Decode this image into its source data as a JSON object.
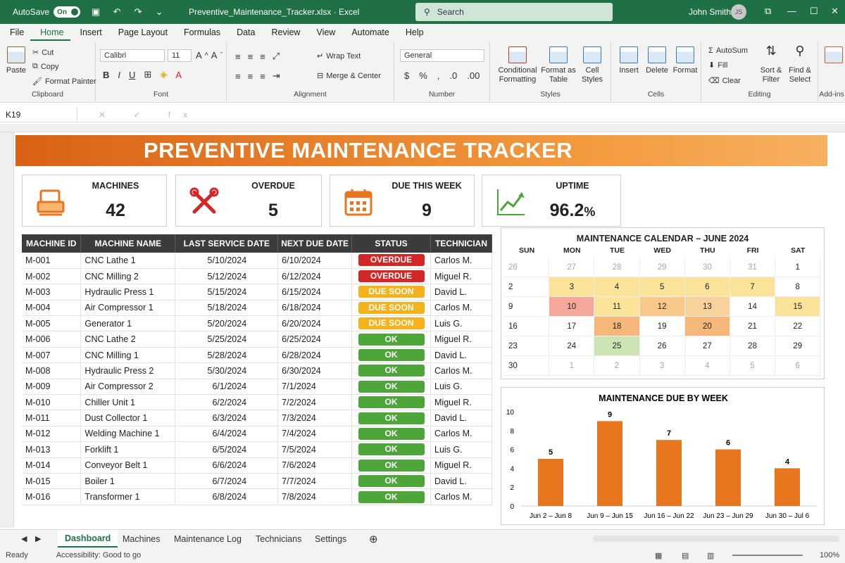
{
  "titlebar": {
    "autosave_label": "AutoSave",
    "toggle": "On",
    "filename": "Preventive_Maintenance_Tracker.xlsx · Excel",
    "search_placeholder": "Search",
    "user_name": "John Smith",
    "user_initials": "JS"
  },
  "menu": [
    "File",
    "Home",
    "Insert",
    "Page Layout",
    "Formulas",
    "Data",
    "Review",
    "View",
    "Automate",
    "Help"
  ],
  "ribbon": {
    "clipboard": {
      "paste": "Paste",
      "cut": "Cut",
      "copy": "Copy",
      "format_painter": "Format Painter",
      "label": "Clipboard"
    },
    "font": {
      "name": "Calibri",
      "size": "11",
      "label": "Font"
    },
    "alignment": {
      "wrap": "Wrap Text",
      "merge": "Merge & Center",
      "label": "Alignment"
    },
    "number": {
      "format": "General",
      "label": "Number"
    },
    "styles": {
      "conditional": "Conditional Formatting",
      "table": "Format as Table",
      "cell": "Cell Styles",
      "label": "Styles"
    },
    "cells": {
      "insert": "Insert",
      "delete": "Delete",
      "format": "Format",
      "label": "Cells"
    },
    "editing": {
      "autosum": "AutoSum",
      "fill": "Fill",
      "clear": "Clear",
      "sort": "Sort & Filter",
      "find": "Find & Select",
      "label": "Editing"
    },
    "addins": {
      "label": "Add-ins"
    }
  },
  "formula_bar": {
    "name_box": "K19",
    "fx": "✕ ✓ fx"
  },
  "banner": "PREVENTIVE MAINTENANCE TRACKER",
  "kpis": [
    {
      "label": "MACHINES",
      "value": "42",
      "icon": "machine-icon"
    },
    {
      "label": "OVERDUE",
      "value": "5",
      "icon": "tools-icon"
    },
    {
      "label": "DUE THIS WEEK",
      "value": "9",
      "icon": "calendar-icon"
    },
    {
      "label": "UPTIME",
      "value": "96.2",
      "unit": "%",
      "icon": "trend-up-icon"
    }
  ],
  "table": {
    "headers": [
      "MACHINE ID",
      "MACHINE NAME",
      "LAST SERVICE DATE",
      "NEXT DUE DATE",
      "STATUS",
      "TECHNICIAN"
    ],
    "rows": [
      [
        "M-001",
        "CNC Lathe 1",
        "5/10/2024",
        "6/10/2024",
        "OVERDUE",
        "Carlos M."
      ],
      [
        "M-002",
        "CNC Milling 2",
        "5/12/2024",
        "6/12/2024",
        "OVERDUE",
        "Miguel R."
      ],
      [
        "M-003",
        "Hydraulic Press 1",
        "5/15/2024",
        "6/15/2024",
        "DUE SOON",
        "David L."
      ],
      [
        "M-004",
        "Air Compressor 1",
        "5/18/2024",
        "6/18/2024",
        "DUE SOON",
        "Carlos M."
      ],
      [
        "M-005",
        "Generator 1",
        "5/20/2024",
        "6/20/2024",
        "DUE SOON",
        "Luis G."
      ],
      [
        "M-006",
        "CNC Lathe 2",
        "5/25/2024",
        "6/25/2024",
        "OK",
        "Miguel R."
      ],
      [
        "M-007",
        "CNC Milling 1",
        "5/28/2024",
        "6/28/2024",
        "OK",
        "David L."
      ],
      [
        "M-008",
        "Hydraulic Press 2",
        "5/30/2024",
        "6/30/2024",
        "OK",
        "Carlos M."
      ],
      [
        "M-009",
        "Air Compressor 2",
        "6/1/2024",
        "7/1/2024",
        "OK",
        "Luis G."
      ],
      [
        "M-010",
        "Chiller Unit 1",
        "6/2/2024",
        "7/2/2024",
        "OK",
        "Miguel R."
      ],
      [
        "M-011",
        "Dust Collector 1",
        "6/3/2024",
        "7/3/2024",
        "OK",
        "David L."
      ],
      [
        "M-012",
        "Welding Machine 1",
        "6/4/2024",
        "7/4/2024",
        "OK",
        "Carlos M."
      ],
      [
        "M-013",
        "Forklift 1",
        "6/5/2024",
        "7/5/2024",
        "OK",
        "Luis G."
      ],
      [
        "M-014",
        "Conveyor Belt 1",
        "6/6/2024",
        "7/6/2024",
        "OK",
        "Miguel R."
      ],
      [
        "M-015",
        "Boiler 1",
        "6/7/2024",
        "7/7/2024",
        "OK",
        "David L."
      ],
      [
        "M-016",
        "Transformer 1",
        "6/8/2024",
        "7/8/2024",
        "OK",
        "Carlos M."
      ]
    ],
    "status_colors": {
      "OVERDUE": "#d32626",
      "DUE SOON": "#f5b21b",
      "OK": "#4ea53a"
    }
  },
  "calendar": {
    "title": "MAINTENANCE CALENDAR – JUNE 2024",
    "dow": [
      "SUN",
      "MON",
      "TUE",
      "WED",
      "THU",
      "FRI",
      "SAT"
    ],
    "weeks": [
      [
        {
          "d": "26",
          "m": true
        },
        {
          "d": "27",
          "m": true
        },
        {
          "d": "28",
          "m": true
        },
        {
          "d": "29",
          "m": true
        },
        {
          "d": "30",
          "m": true
        },
        {
          "d": "31",
          "m": true
        },
        {
          "d": "1"
        }
      ],
      [
        {
          "d": "2"
        },
        {
          "d": "3",
          "c": "#fbe39a"
        },
        {
          "d": "4",
          "c": "#fbe39a"
        },
        {
          "d": "5",
          "c": "#fbe39a"
        },
        {
          "d": "6",
          "c": "#fbe39a"
        },
        {
          "d": "7",
          "c": "#fbe39a"
        },
        {
          "d": "8"
        }
      ],
      [
        {
          "d": "9"
        },
        {
          "d": "10",
          "c": "#f4a79a"
        },
        {
          "d": "11",
          "c": "#fbe39a"
        },
        {
          "d": "12",
          "c": "#f8c88b"
        },
        {
          "d": "13",
          "c": "#f8d29a"
        },
        {
          "d": "14"
        },
        {
          "d": "15",
          "c": "#fbe39a"
        }
      ],
      [
        {
          "d": "16"
        },
        {
          "d": "17"
        },
        {
          "d": "18",
          "c": "#f6b77a"
        },
        {
          "d": "19"
        },
        {
          "d": "20",
          "c": "#f6b77a"
        },
        {
          "d": "21"
        },
        {
          "d": "22"
        }
      ],
      [
        {
          "d": "23"
        },
        {
          "d": "24"
        },
        {
          "d": "25",
          "c": "#cde5b4"
        },
        {
          "d": "26"
        },
        {
          "d": "27"
        },
        {
          "d": "28"
        },
        {
          "d": "29"
        }
      ],
      [
        {
          "d": "30"
        },
        {
          "d": "1",
          "m": true
        },
        {
          "d": "2",
          "m": true
        },
        {
          "d": "3",
          "m": true
        },
        {
          "d": "4",
          "m": true
        },
        {
          "d": "5",
          "m": true
        },
        {
          "d": "6",
          "m": true
        }
      ]
    ]
  },
  "chart_data": {
    "type": "bar",
    "title": "MAINTENANCE DUE BY WEEK",
    "categories": [
      "Jun 2 – Jun 8",
      "Jun 9 – Jun 15",
      "Jun 16 – Jun 22",
      "Jun 23 – Jun 29",
      "Jun 30 – Jul 6"
    ],
    "values": [
      5,
      9,
      7,
      6,
      4
    ],
    "ylim": [
      0,
      10
    ],
    "yticks": [
      0,
      2,
      4,
      6,
      8,
      10
    ],
    "color": "#e8761e",
    "grid": false
  },
  "sheets": [
    "Dashboard",
    "Machines",
    "Maintenance Log",
    "Technicians",
    "Settings"
  ],
  "status": {
    "ready": "Ready",
    "accessibility": "Accessibility: Good to go",
    "zoom": "100%"
  }
}
